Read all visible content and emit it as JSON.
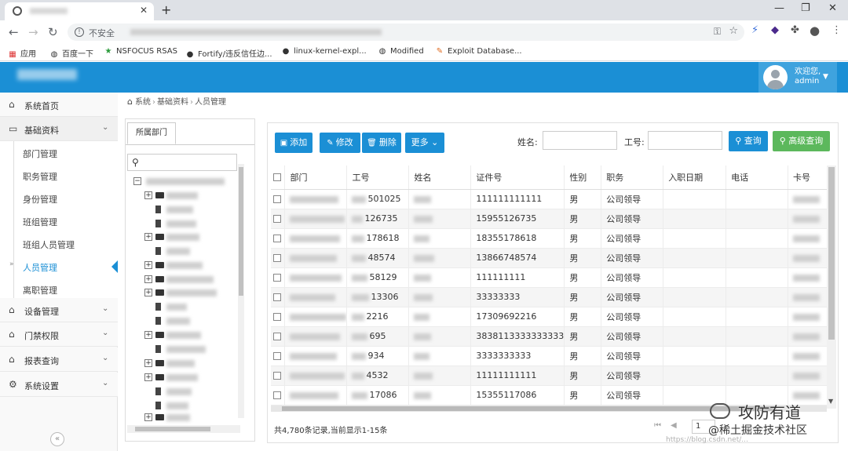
{
  "browser": {
    "tab_title": "",
    "insecure_label": "不安全",
    "bookmarks": [
      "应用",
      "百度一下",
      "NSFOCUS RSAS",
      "Fortify/违反信任边...",
      "linux-kernel-expl...",
      "Modified",
      "Exploit Database..."
    ]
  },
  "header": {
    "welcome": "欢迎您,",
    "user": "admin"
  },
  "sidebar": {
    "items": [
      {
        "label": "系统首页",
        "icon": "home-icon"
      },
      {
        "label": "基础资料",
        "icon": "monitor-icon"
      },
      {
        "label": "设备管理",
        "icon": "home-icon"
      },
      {
        "label": "门禁权限",
        "icon": "home-icon"
      },
      {
        "label": "报表查询",
        "icon": "home-icon"
      },
      {
        "label": "系统设置",
        "icon": "gear-icon"
      }
    ],
    "subitems": [
      "部门管理",
      "职务管理",
      "身份管理",
      "班组管理",
      "班组人员管理",
      "人员管理",
      "离职管理"
    ]
  },
  "breadcrumb": {
    "items": [
      "系统",
      "基础资料",
      "人员管理"
    ]
  },
  "tree": {
    "tab": "所属部门"
  },
  "toolbar": {
    "add": "添加",
    "edit": "修改",
    "delete": "删除",
    "more": "更多",
    "name_label": "姓名:",
    "id_label": "工号:",
    "query": "查询",
    "advanced_query": "高级查询"
  },
  "grid": {
    "columns": [
      "部门",
      "工号",
      "姓名",
      "证件号",
      "性别",
      "职务",
      "入职日期",
      "电话",
      "卡号"
    ],
    "rows": [
      {
        "id": "501025",
        "cert": "111111111111",
        "gender": "男",
        "title": "公司领导"
      },
      {
        "id": "126735",
        "cert": "15955126735",
        "gender": "男",
        "title": "公司领导"
      },
      {
        "id": "178618",
        "cert": "18355178618",
        "gender": "男",
        "title": "公司领导"
      },
      {
        "id": "48574",
        "cert": "13866748574",
        "gender": "男",
        "title": "公司领导"
      },
      {
        "id": "58129",
        "cert": "111111111",
        "gender": "男",
        "title": "公司领导"
      },
      {
        "id": "13306",
        "cert": "33333333",
        "gender": "男",
        "title": "公司领导"
      },
      {
        "id": "2216",
        "cert": "17309692216",
        "gender": "男",
        "title": "公司领导"
      },
      {
        "id": "695",
        "cert": "3838113333333333",
        "gender": "男",
        "title": "公司领导"
      },
      {
        "id": "934",
        "cert": "3333333333",
        "gender": "男",
        "title": "公司领导"
      },
      {
        "id": "4532",
        "cert": "11111111111",
        "gender": "男",
        "title": "公司领导"
      },
      {
        "id": "17086",
        "cert": "15355117086",
        "gender": "男",
        "title": "公司领导"
      }
    ],
    "footer": "共4,780条记录,当前显示1-15条",
    "page": "1"
  },
  "watermark": {
    "title": "攻防有道",
    "subtitle": "@稀土掘金技术社区",
    "url": "https://blog.csdn.net/..."
  },
  "colors": {
    "header": "#1b8fd5",
    "advanced": "#5cb85c"
  }
}
